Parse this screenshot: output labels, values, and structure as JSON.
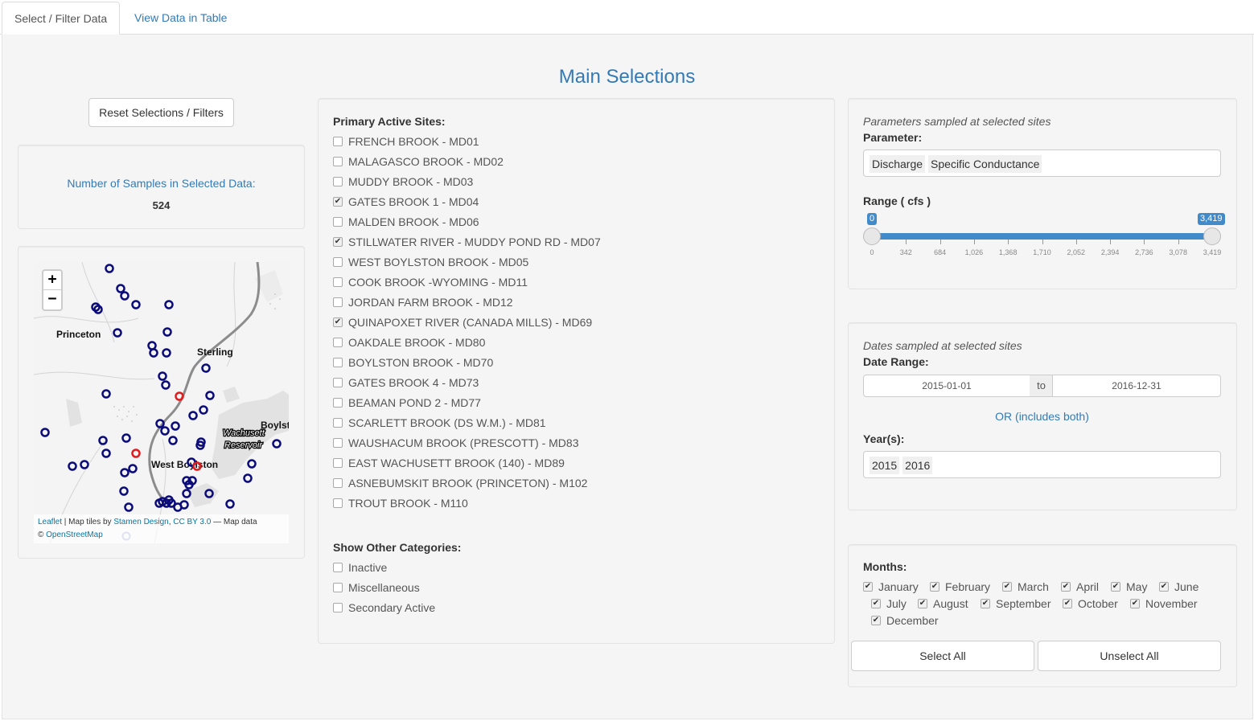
{
  "tabs": [
    {
      "label": "Select / Filter Data"
    },
    {
      "label": "View Data in Table"
    }
  ],
  "title": "Main Selections",
  "reset_button": "Reset Selections / Filters",
  "sample_count": {
    "label": "Number of Samples in Selected Data:",
    "value": "524"
  },
  "map": {
    "zoom_in": "+",
    "zoom_out": "−",
    "places": [
      "Princeton",
      "Sterling",
      "Boylst",
      "Wachusett",
      "Reservoir",
      "West Boylston"
    ],
    "attribution": {
      "leaflet": "Leaflet",
      "tiles_text": " | Map tiles by ",
      "stamen": "Stamen Design",
      "cc": "CC BY 3.0",
      "map_data": " — Map data",
      "copy": "© ",
      "osm": "OpenStreetMap"
    }
  },
  "sites": {
    "label": "Primary Active Sites:",
    "items": [
      {
        "label": "FRENCH BROOK - MD01",
        "checked": false
      },
      {
        "label": "MALAGASCO BROOK - MD02",
        "checked": false
      },
      {
        "label": "MUDDY BROOK - MD03",
        "checked": false
      },
      {
        "label": "GATES BROOK 1 - MD04",
        "checked": true
      },
      {
        "label": "MALDEN BROOK - MD06",
        "checked": false
      },
      {
        "label": "STILLWATER RIVER - MUDDY POND RD - MD07",
        "checked": true
      },
      {
        "label": "WEST BOYLSTON BROOK - MD05",
        "checked": false
      },
      {
        "label": "COOK BROOK -WYOMING - MD11",
        "checked": false
      },
      {
        "label": "JORDAN FARM BROOK - MD12",
        "checked": false
      },
      {
        "label": "QUINAPOXET RIVER (CANADA MILLS) - MD69",
        "checked": true
      },
      {
        "label": "OAKDALE BROOK - MD80",
        "checked": false
      },
      {
        "label": "BOYLSTON BROOK - MD70",
        "checked": false
      },
      {
        "label": "GATES BROOK 4 - MD73",
        "checked": false
      },
      {
        "label": "BEAMAN POND 2 - MD77",
        "checked": false
      },
      {
        "label": "SCARLETT BROOK (DS W.M.) - MD81",
        "checked": false
      },
      {
        "label": "WAUSHACUM BROOK (PRESCOTT) - MD83",
        "checked": false
      },
      {
        "label": "EAST WACHUSETT BROOK (140) - MD89",
        "checked": false
      },
      {
        "label": "ASNEBUMSKIT BROOK (PRINCETON) - M102",
        "checked": false
      },
      {
        "label": "TROUT BROOK - M110",
        "checked": false
      }
    ]
  },
  "other_categories": {
    "label": "Show Other Categories:",
    "items": [
      {
        "label": "Inactive",
        "checked": false
      },
      {
        "label": "Miscellaneous",
        "checked": false
      },
      {
        "label": "Secondary Active",
        "checked": false
      }
    ]
  },
  "parameters": {
    "caption": "Parameters sampled at selected sites",
    "label": "Parameter:",
    "selected": [
      "Discharge",
      "Specific Conductance"
    ],
    "range_label": "Range ( cfs )",
    "range_min": 0,
    "range_max": 3419,
    "range_from_label": "0",
    "range_to_label": "3,419",
    "ticks": [
      "0",
      "342",
      "684",
      "1,026",
      "1,368",
      "1,710",
      "2,052",
      "2,394",
      "2,736",
      "3,078",
      "3,419"
    ]
  },
  "dates": {
    "caption": "Dates sampled at selected sites",
    "label": "Date Range:",
    "start": "2015-01-01",
    "separator": "to",
    "end": "2016-12-31",
    "or_text": "OR (includes both)",
    "years_label": "Year(s):",
    "years": [
      "2015",
      "2016"
    ]
  },
  "months": {
    "label": "Months:",
    "items": [
      {
        "label": "January",
        "checked": true
      },
      {
        "label": "February",
        "checked": true
      },
      {
        "label": "March",
        "checked": true
      },
      {
        "label": "April",
        "checked": true
      },
      {
        "label": "May",
        "checked": true
      },
      {
        "label": "June",
        "checked": true
      },
      {
        "label": "July",
        "checked": true
      },
      {
        "label": "August",
        "checked": true
      },
      {
        "label": "September",
        "checked": true
      },
      {
        "label": "October",
        "checked": true
      },
      {
        "label": "November",
        "checked": true
      },
      {
        "label": "December",
        "checked": true
      }
    ],
    "select_all": "Select All",
    "unselect_all": "Unselect All"
  },
  "colors": {
    "accent": "#337ab7",
    "slider": "#428bca",
    "marker_selected": "#e31a1c",
    "marker_default": "#0b0b7a"
  }
}
